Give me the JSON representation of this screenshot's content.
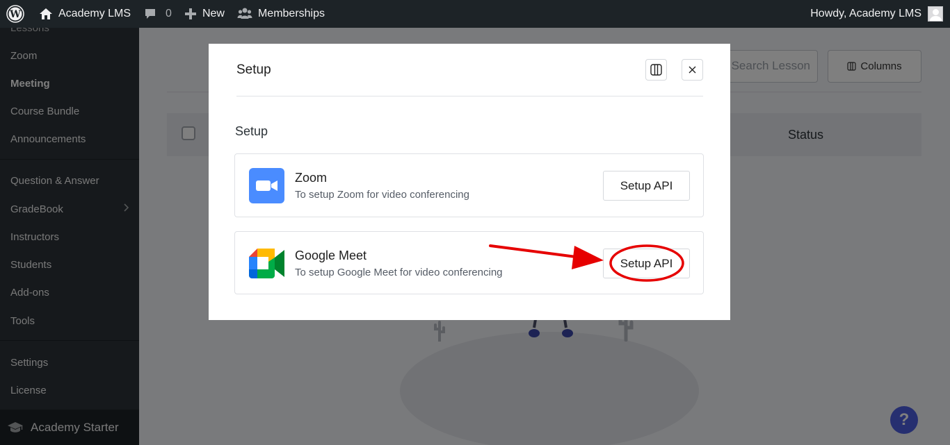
{
  "adminbar": {
    "site_name": "Academy LMS",
    "comments_count": "0",
    "new_label": "New",
    "memberships_label": "Memberships",
    "howdy": "Howdy, Academy LMS",
    "icons": [
      "wordpress-icon",
      "home-icon",
      "comment-icon",
      "plus-icon",
      "users-icon"
    ]
  },
  "sidebar": {
    "items": [
      {
        "label": "Lessons"
      },
      {
        "label": "Zoom"
      },
      {
        "label": "Meeting",
        "current": true
      },
      {
        "label": "Course Bundle"
      },
      {
        "label": "Announcements"
      },
      {
        "label": "Question & Answer"
      },
      {
        "label": "GradeBook"
      },
      {
        "label": "Instructors"
      },
      {
        "label": "Students"
      },
      {
        "label": "Add-ons"
      },
      {
        "label": "Tools"
      },
      {
        "label": "Settings"
      },
      {
        "label": "License"
      }
    ],
    "brand": "Academy Starter"
  },
  "main": {
    "search_placeholder": "Search Lesson",
    "columns_label": "Columns",
    "status_header": "Status"
  },
  "modal": {
    "title": "Setup",
    "section_title": "Setup",
    "cards": [
      {
        "name": "Zoom",
        "description": "To setup Zoom for video conferencing",
        "button_label": "Setup API",
        "logo": "zoom-logo-icon"
      },
      {
        "name": "Google Meet",
        "description": "To setup Google Meet for video conferencing",
        "button_label": "Setup API",
        "logo": "google-meet-logo-icon"
      }
    ]
  },
  "help": {
    "label": "?"
  },
  "colors": {
    "adminbar": "#1d2327",
    "sidebar": "#2c3338",
    "zoom_blue": "#4a8cff",
    "annotation_red": "#e60000",
    "help_button": "#4d5fe0"
  }
}
